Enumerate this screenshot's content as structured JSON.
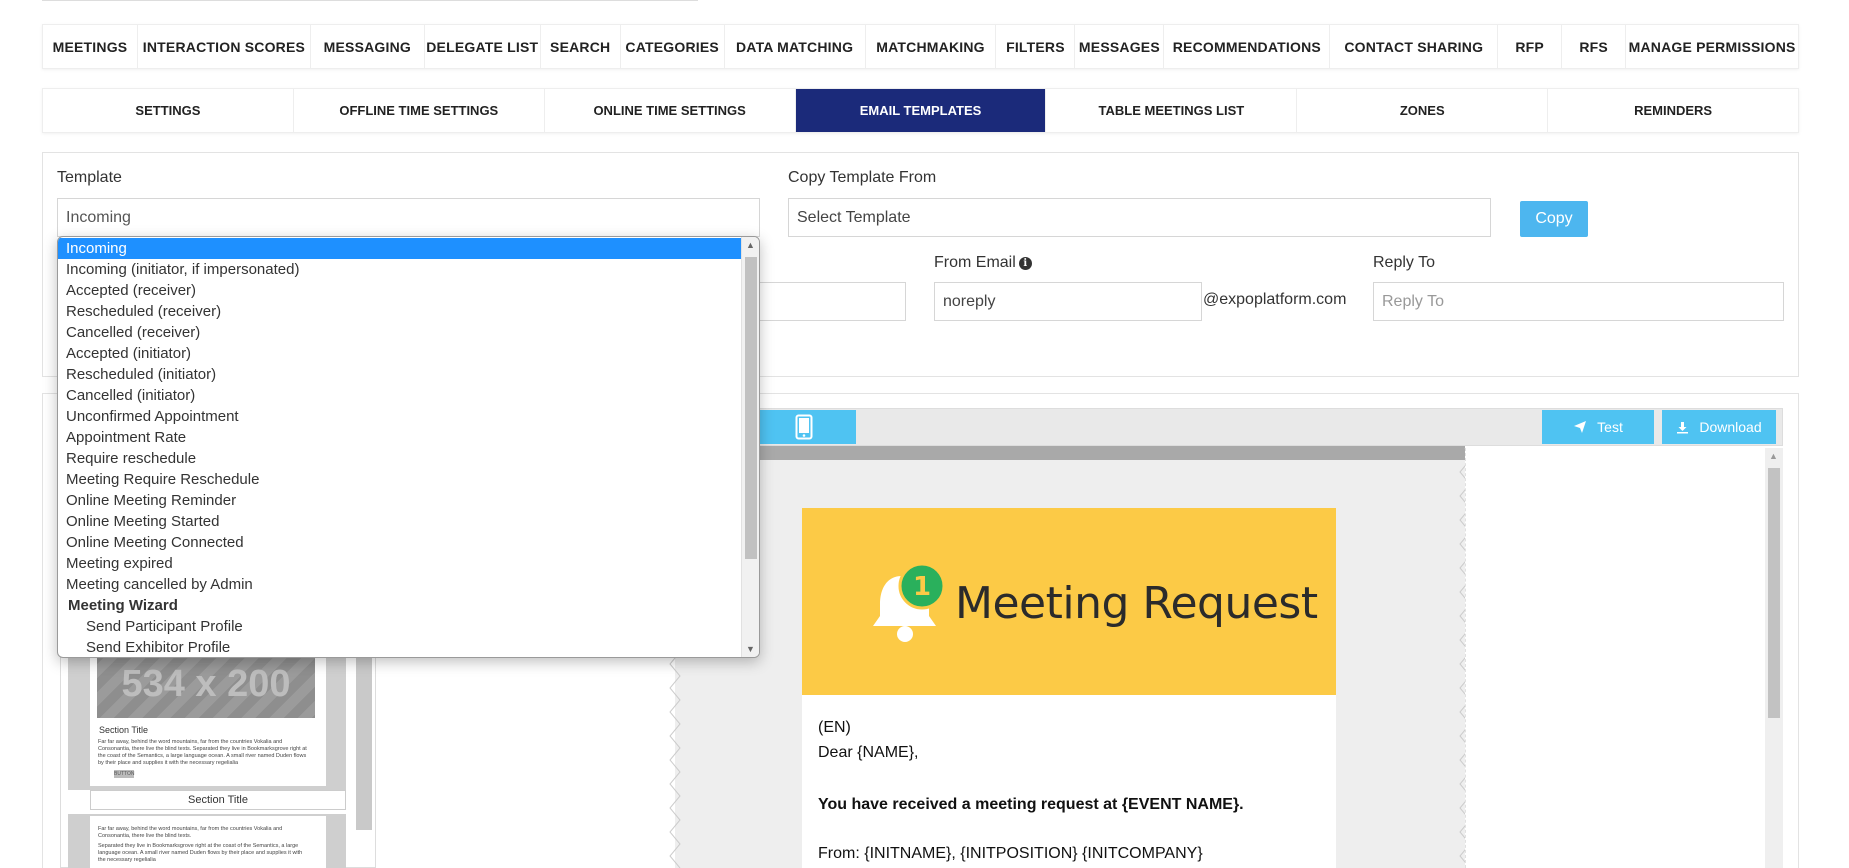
{
  "top_nav": {
    "items": [
      {
        "label": "MEETINGS"
      },
      {
        "label": "INTERACTION SCORES"
      },
      {
        "label": "MESSAGING"
      },
      {
        "label": "DELEGATE LIST"
      },
      {
        "label": "SEARCH"
      },
      {
        "label": "CATEGORIES"
      },
      {
        "label": "DATA MATCHING"
      },
      {
        "label": "MATCHMAKING"
      },
      {
        "label": "FILTERS"
      },
      {
        "label": "MESSAGES"
      },
      {
        "label": "RECOMMENDATIONS"
      },
      {
        "label": "CONTACT SHARING"
      },
      {
        "label": "RFP"
      },
      {
        "label": "RFS"
      },
      {
        "label": "MANAGE PERMISSIONS"
      }
    ]
  },
  "sub_nav": {
    "items": [
      {
        "label": "SETTINGS"
      },
      {
        "label": "OFFLINE TIME SETTINGS"
      },
      {
        "label": "ONLINE TIME SETTINGS"
      },
      {
        "label": "EMAIL TEMPLATES"
      },
      {
        "label": "TABLE MEETINGS LIST"
      },
      {
        "label": "ZONES"
      },
      {
        "label": "REMINDERS"
      }
    ],
    "active": "EMAIL TEMPLATES",
    "active_color": "#1b2a7a"
  },
  "form": {
    "template_label": "Template",
    "template_value": "Incoming",
    "copy_from_label": "Copy Template From",
    "copy_from_placeholder": "Select Template",
    "copy_button": "Copy",
    "from_email_label": "From Email",
    "from_email_value": "noreply",
    "email_domain": "@expoplatform.com",
    "reply_to_label": "Reply To",
    "reply_to_placeholder": "Reply To"
  },
  "dropdown": {
    "selected": "Incoming",
    "options": [
      "Incoming",
      "Incoming (initiator, if impersonated)",
      "Accepted (receiver)",
      "Rescheduled (receiver)",
      "Cancelled (receiver)",
      "Accepted (initiator)",
      "Rescheduled (initiator)",
      "Cancelled (initiator)",
      "Unconfirmed Appointment",
      "Appointment Rate",
      "Require reschedule",
      "Meeting Require Reschedule",
      "Online Meeting Reminder",
      "Online Meeting Started",
      "Online Meeting Connected",
      "Meeting expired",
      "Meeting cancelled by Admin"
    ],
    "group_label": "Meeting Wizard",
    "group_options": [
      "Send Participant Profile",
      "Send Exhibitor Profile"
    ],
    "highlight_color": "#1e90ff"
  },
  "editor": {
    "test_button": "Test",
    "download_button": "Download",
    "button_color": "#4fc3f2",
    "email": {
      "header_title": "Meeting Request",
      "badge_count": "1",
      "header_color": "#fcca46",
      "lang": "(EN)",
      "greeting": "Dear {NAME},",
      "intro": "You have received a meeting request at {EVENT NAME}.",
      "from_line": "From: {INITNAME}, {INITPOSITION} {INITCOMPANY}"
    },
    "block_preview": {
      "placeholder": "534 x 200",
      "section_title": "Section Title",
      "section_text": "Far far away, behind the word mountains, far from the countries Vokalia and Consonantia, there live the blind texts. Separated they live in Bookmarksgrove right at the coast of the Semantics, a large language ocean. A small river named Duden flows by their place and supplies it with the necessary regelialia",
      "button_label": "BUTTON",
      "section_title_2": "Section Title",
      "section_text_2a": "Far far away, behind the word mountains, far from the countries Vokalia and Consonantia, there live the blind texts.",
      "section_text_2b": "Separated they live in Bookmarksgrove right at the coast of the Semantics, a large language ocean. A small river named Duden flows by their place and supplies it with the necessary regelialia"
    }
  }
}
